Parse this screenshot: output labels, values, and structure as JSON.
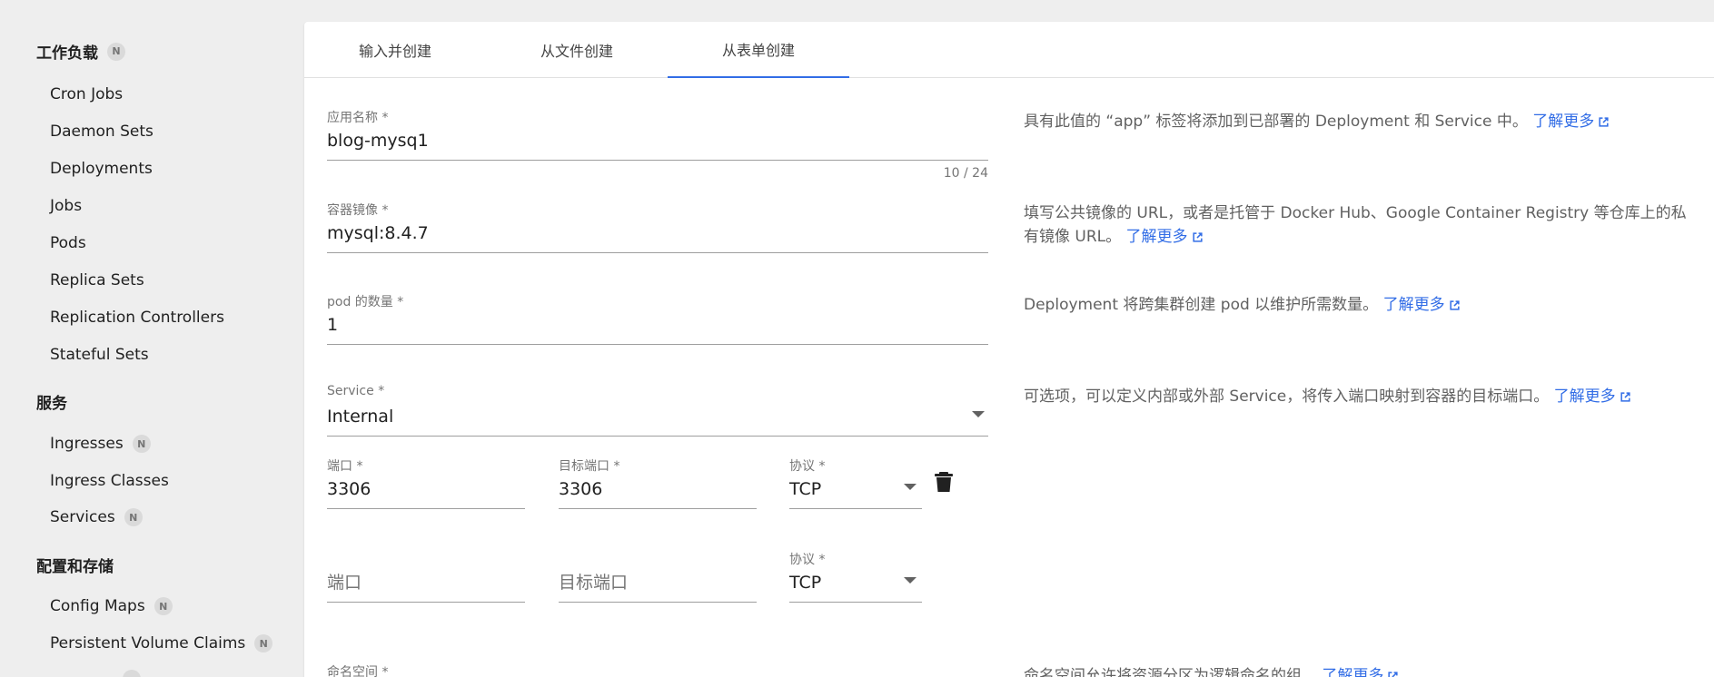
{
  "sidebar": {
    "sections": [
      {
        "title": "工作负载",
        "badge": "N"
      },
      {
        "title": "服务"
      },
      {
        "title": "配置和存储"
      }
    ],
    "workloads": [
      {
        "label": "Cron Jobs"
      },
      {
        "label": "Daemon Sets"
      },
      {
        "label": "Deployments"
      },
      {
        "label": "Jobs"
      },
      {
        "label": "Pods"
      },
      {
        "label": "Replica Sets"
      },
      {
        "label": "Replication Controllers"
      },
      {
        "label": "Stateful Sets"
      }
    ],
    "services": [
      {
        "label": "Ingresses",
        "badge": "N"
      },
      {
        "label": "Ingress Classes"
      },
      {
        "label": "Services",
        "badge": "N"
      }
    ],
    "config": [
      {
        "label": "Config Maps",
        "badge": "N"
      },
      {
        "label": "Persistent Volume Claims",
        "badge": "N"
      }
    ]
  },
  "tabs": [
    {
      "label": "输入并创建"
    },
    {
      "label": "从文件创建"
    },
    {
      "label": "从表单创建",
      "active": true
    }
  ],
  "form": {
    "app_name": {
      "label": "应用名称 *",
      "value": "blog-mysq1",
      "counter": "10 / 24"
    },
    "image": {
      "label": "容器镜像 *",
      "value": "mysql:8.4.7"
    },
    "pods": {
      "label": "pod 的数量 *",
      "value": "1"
    },
    "service": {
      "label": "Service *",
      "value": "Internal"
    },
    "port_row1": {
      "port_label": "端口 *",
      "port_value": "3306",
      "target_label": "目标端口 *",
      "target_value": "3306",
      "protocol_label": "协议 *",
      "protocol_value": "TCP"
    },
    "port_row2": {
      "port_placeholder": "端口",
      "target_placeholder": "目标端口",
      "protocol_label": "协议 *",
      "protocol_value": "TCP"
    },
    "namespace": {
      "label": "命名空间 *"
    }
  },
  "help": {
    "app_name": "具有此值的 “app” 标签将添加到已部署的 Deployment 和 Service 中。",
    "image": "填写公共镜像的 URL，或者是托管于 Docker Hub、Google Container Registry 等仓库上的私有镜像 URL。",
    "pods": "Deployment 将跨集群创建 pod 以维护所需数量。",
    "service": "可选项，可以定义内部或外部 Service，将传入端口映射到容器的目标端口。",
    "namespace": "命名空间允许将资源分区为逻辑命名的组。",
    "learn_more": "了解更多"
  },
  "colors": {
    "accent": "#326de6",
    "sidebar_bg": "#eeeeee"
  },
  "icons": {
    "delete": "trash-icon",
    "external": "open-in-new-icon",
    "dropdown": "arrow-drop-down-icon"
  }
}
